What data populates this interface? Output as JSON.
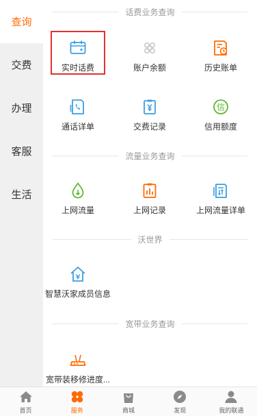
{
  "sidebar": {
    "items": [
      {
        "label": "查询",
        "active": true
      },
      {
        "label": "交费"
      },
      {
        "label": "办理"
      },
      {
        "label": "客服"
      },
      {
        "label": "生活"
      }
    ]
  },
  "sections": {
    "fee": {
      "title": "话费业务查询"
    },
    "traffic": {
      "title": "流量业务查询"
    },
    "wo": {
      "title": "沃世界"
    },
    "broadband": {
      "title": "宽带业务查询"
    }
  },
  "items": {
    "realtime_fee": "实时话费",
    "balance": "账户余额",
    "history_bill": "历史账单",
    "call_detail": "通话详单",
    "payment_record": "交费记录",
    "credit_limit": "信用额度",
    "data_usage": "上网流量",
    "data_record": "上网记录",
    "data_detail": "上网流量详单",
    "smart_family": "智慧沃家成员信息",
    "broadband_progress": "宽带装移修进度..."
  },
  "tabbar": {
    "items": [
      {
        "label": "首页"
      },
      {
        "label": "服务",
        "active": true
      },
      {
        "label": "商城"
      },
      {
        "label": "发现"
      },
      {
        "label": "我的联通"
      }
    ]
  },
  "colors": {
    "accent": "#ff6a00",
    "blue": "#3a9ee4",
    "green": "#5fb832",
    "highlight_border": "#e0312e",
    "sidebar_bg": "#f0f0f0"
  }
}
